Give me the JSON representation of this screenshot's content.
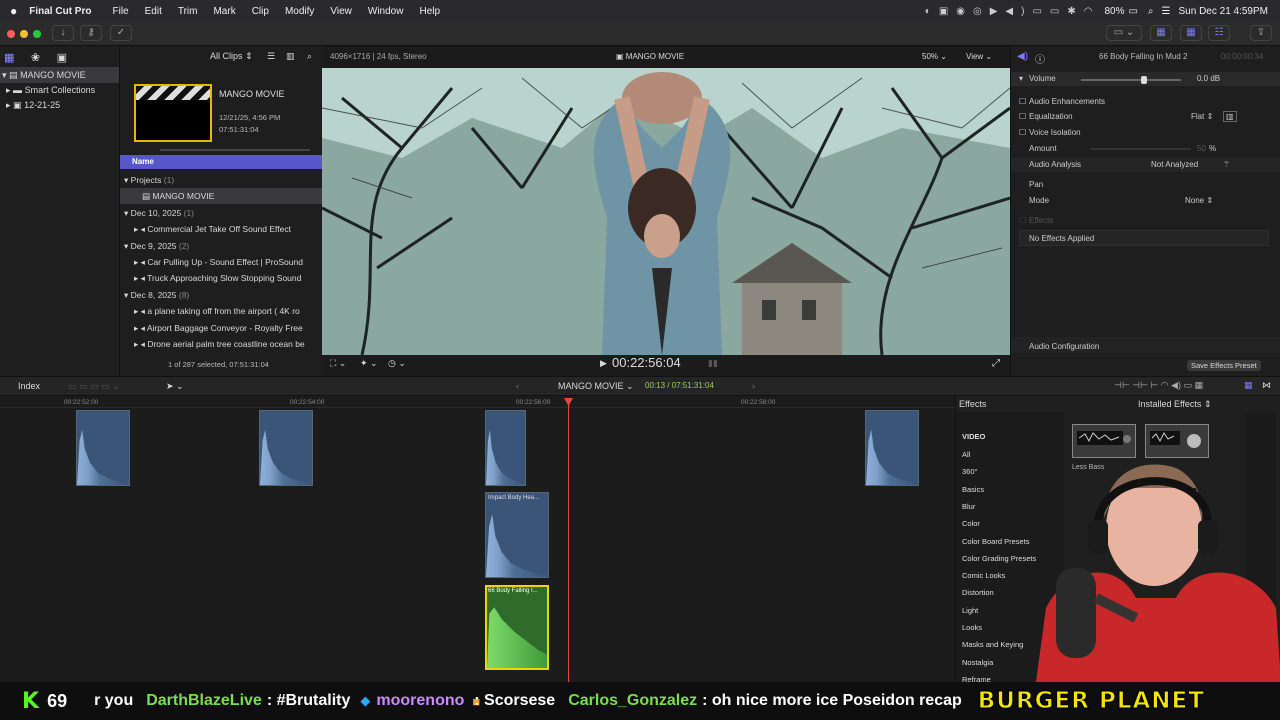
{
  "menubar": {
    "app": "Final Cut Pro",
    "items": [
      "File",
      "Edit",
      "Trim",
      "Mark",
      "Clip",
      "Modify",
      "View",
      "Window",
      "Help"
    ],
    "battery": "80%",
    "datetime": "Sun Dec 21  4:59PM"
  },
  "library": {
    "name": "MANGO MOVIE",
    "items": [
      "Smart Collections",
      "12-21-25"
    ]
  },
  "browser": {
    "filter": "All Clips",
    "thumb_title": "MANGO MOVIE",
    "thumb_date": "12/21/25, 4:56 PM",
    "thumb_duration": "07:51:31:04",
    "column": "Name",
    "rows": [
      {
        "type": "group",
        "label": "Projects",
        "count": "(1)"
      },
      {
        "type": "item",
        "label": "MANGO MOVIE",
        "selected": true
      },
      {
        "type": "group",
        "label": "Dec 10, 2025",
        "count": "(1)"
      },
      {
        "type": "item",
        "label": "Commercial Jet Take Off Sound Effect"
      },
      {
        "type": "group",
        "label": "Dec 9, 2025",
        "count": "(2)"
      },
      {
        "type": "item",
        "label": "Car Pulling Up - Sound Effect  |  ProSound"
      },
      {
        "type": "item",
        "label": "Truck Approaching Slow Stopping Sound"
      },
      {
        "type": "group",
        "label": "Dec 8, 2025",
        "count": "(8)"
      },
      {
        "type": "item",
        "label": "a plane taking off from the airport ( 4K ro"
      },
      {
        "type": "item",
        "label": "Airport Baggage Conveyor - Royalty Free"
      },
      {
        "type": "item",
        "label": "Drone aerial palm tree coastline ocean be"
      }
    ],
    "status": "1 of 287 selected, 07:51:31:04"
  },
  "viewer": {
    "format": "4096×1716 | 24 fps, Stereo",
    "title": "MANGO MOVIE",
    "zoom": "50%",
    "view": "View",
    "timecode": "00:22:56:04"
  },
  "inspector": {
    "clip": "66 Body Falling In Mud 2",
    "frame": "00:00:00:34",
    "volume_label": "Volume",
    "volume_value": "0.0 dB",
    "enh": "Audio Enhancements",
    "eq": "Equalization",
    "eq_value": "Flat",
    "voice": "Voice Isolation",
    "amount": "Amount",
    "amount_value": "50",
    "amount_unit": "%",
    "analysis": "Audio Analysis",
    "analysis_value": "Not Analyzed",
    "pan": "Pan",
    "mode": "Mode",
    "mode_value": "None",
    "effects": "Effects",
    "no_effects": "No Effects Applied",
    "config": "Audio Configuration",
    "save": "Save Effects Preset"
  },
  "timeline": {
    "index": "Index",
    "project": "MANGO MOVIE",
    "position": "00:13 / 07:51:31:04",
    "ruler": [
      "00:22:52:00",
      "00:22:54:00",
      "00:22:56:00",
      "00:22:58:00"
    ],
    "clip1": "Impact Body Hea...",
    "clip2": "66 Body Falling I..."
  },
  "effects": {
    "title": "Effects",
    "preset": "Installed Effects",
    "section": "VIDEO",
    "list": [
      "All",
      "360°",
      "Basics",
      "Blur",
      "Color",
      "Color Board Presets",
      "Color Grading Presets",
      "Comic Looks",
      "Distortion",
      "Light",
      "Looks",
      "Masks and Keying",
      "Nostalgia",
      "Reframe"
    ],
    "thumb1": "Less Bass"
  },
  "ticker": {
    "k": "K",
    "count": "69",
    "pre": "r you",
    "u1": "DarthBlazeLive",
    "m1": ": #Brutality",
    "u2": "moorenono",
    "m2": ": Scorsese",
    "u3": "Carlos_Gonzalez",
    "m3": ": oh nice more ice Poseidon recap",
    "brand": "BURGER PLANET"
  },
  "colors": {
    "accent": "#5b5bd6",
    "selected_clip": "#3f9a3a",
    "playhead": "#e04a3a",
    "ticker_green": "#7ed957",
    "ticker_purple": "#c98bff"
  }
}
